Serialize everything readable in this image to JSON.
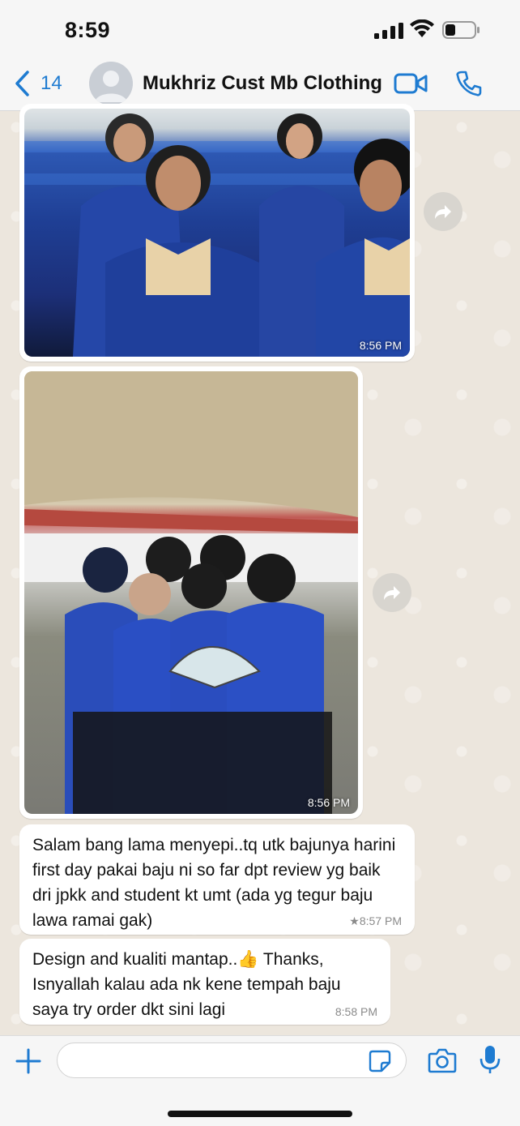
{
  "status_bar": {
    "time": "8:59"
  },
  "header": {
    "back_count": "14",
    "contact_name": "Mukhriz Cust Mb Clothing"
  },
  "messages": [
    {
      "type": "photo",
      "time": "8:56 PM"
    },
    {
      "type": "photo",
      "time": "8:56 PM"
    },
    {
      "type": "text",
      "text": "Salam bang lama menyepi..tq utk bajunya harini first day pakai baju ni so far dpt review yg baik dri jpkk and student kt umt (ada yg tegur baju lawa ramai gak)",
      "time": "★8:57 PM"
    },
    {
      "type": "text",
      "text": "Design and kualiti mantap..👍 Thanks, Isnyallah kalau ada nk kene tempah baju saya try order dkt sini lagi",
      "time": "8:58 PM"
    }
  ],
  "icons": {
    "back": "chevron-left-icon",
    "video": "video-call-icon",
    "call": "phone-icon",
    "forward": "forward-icon",
    "plus": "plus-icon",
    "sticker": "sticker-icon",
    "camera": "camera-icon",
    "mic": "microphone-icon"
  },
  "colors": {
    "accent": "#1e7bd1",
    "bubble": "#ffffff",
    "wallpaper": "#efeae2"
  }
}
